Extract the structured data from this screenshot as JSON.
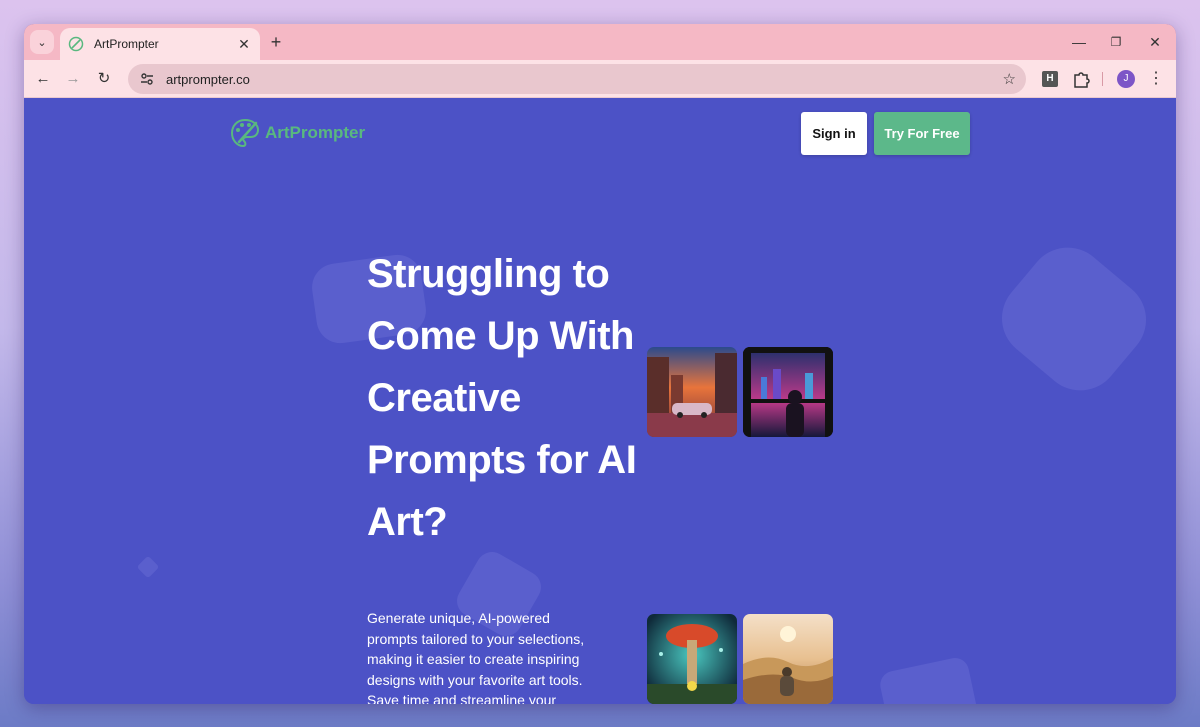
{
  "browser": {
    "tab_title": "ArtPrompter",
    "url": "artprompter.co",
    "extension_label": "H",
    "profile_initial": "J"
  },
  "header": {
    "logo_text": "ArtPrompter",
    "signin_label": "Sign in",
    "try_label": "Try For Free"
  },
  "hero": {
    "title": "Struggling to Come Up With Creative Prompts for AI Art?",
    "description": "Generate unique, AI-powered prompts tailored to your selections, making it easier to create inspiring designs with your favorite art tools. Save time and streamline your"
  },
  "colors": {
    "page_bg": "#4c52c6",
    "brand_green": "#59b87f",
    "tab_strip": "#f5b8c5"
  }
}
